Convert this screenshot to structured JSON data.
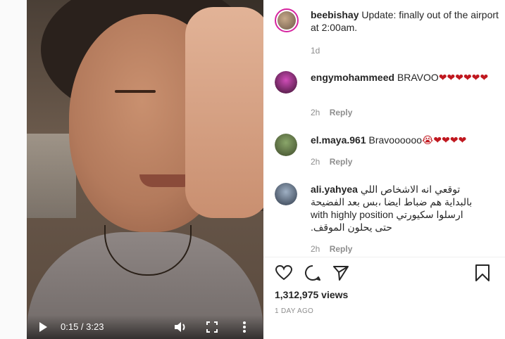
{
  "video": {
    "time_display": "0:15 / 3:23",
    "play_icon": "play-icon",
    "volume_icon": "volume-icon",
    "fullscreen_icon": "fullscreen-icon",
    "more_icon": "more-vertical-icon"
  },
  "caption": {
    "username": "beebishay",
    "text": "Update: finally out of the airport at 2:00am.",
    "age": "1d"
  },
  "comments": [
    {
      "username": "engymohammeed",
      "text_prefix": "BRAVOO",
      "emoji": "❤❤❤❤❤❤",
      "age": "2h",
      "reply_label": "Reply"
    },
    {
      "username": "el.maya.961",
      "text_prefix": "Bravoooooo",
      "emoji": "😭❤❤❤❤",
      "age": "2h",
      "reply_label": "Reply"
    },
    {
      "username": "ali.yahyea",
      "line1": "توقعي انه الاشخاص اللي",
      "line2": "بالبداية هم ضباط ايضا ،بس بعد الفضيحة",
      "line3": "ارسلوا سكيورتي with highly position",
      "line4": "حتى يحلون الموقف.",
      "age": "2h",
      "reply_label": "Reply"
    }
  ],
  "actions": {
    "like_icon": "heart-icon",
    "comment_icon": "comment-icon",
    "share_icon": "share-icon",
    "save_icon": "bookmark-icon"
  },
  "stats": {
    "views": "1,312,975 views",
    "posted": "1 DAY AGO"
  },
  "colors": {
    "heart": "#c0181f",
    "story_ring": "#d6249f",
    "secondary_text": "#8e8e8e"
  }
}
